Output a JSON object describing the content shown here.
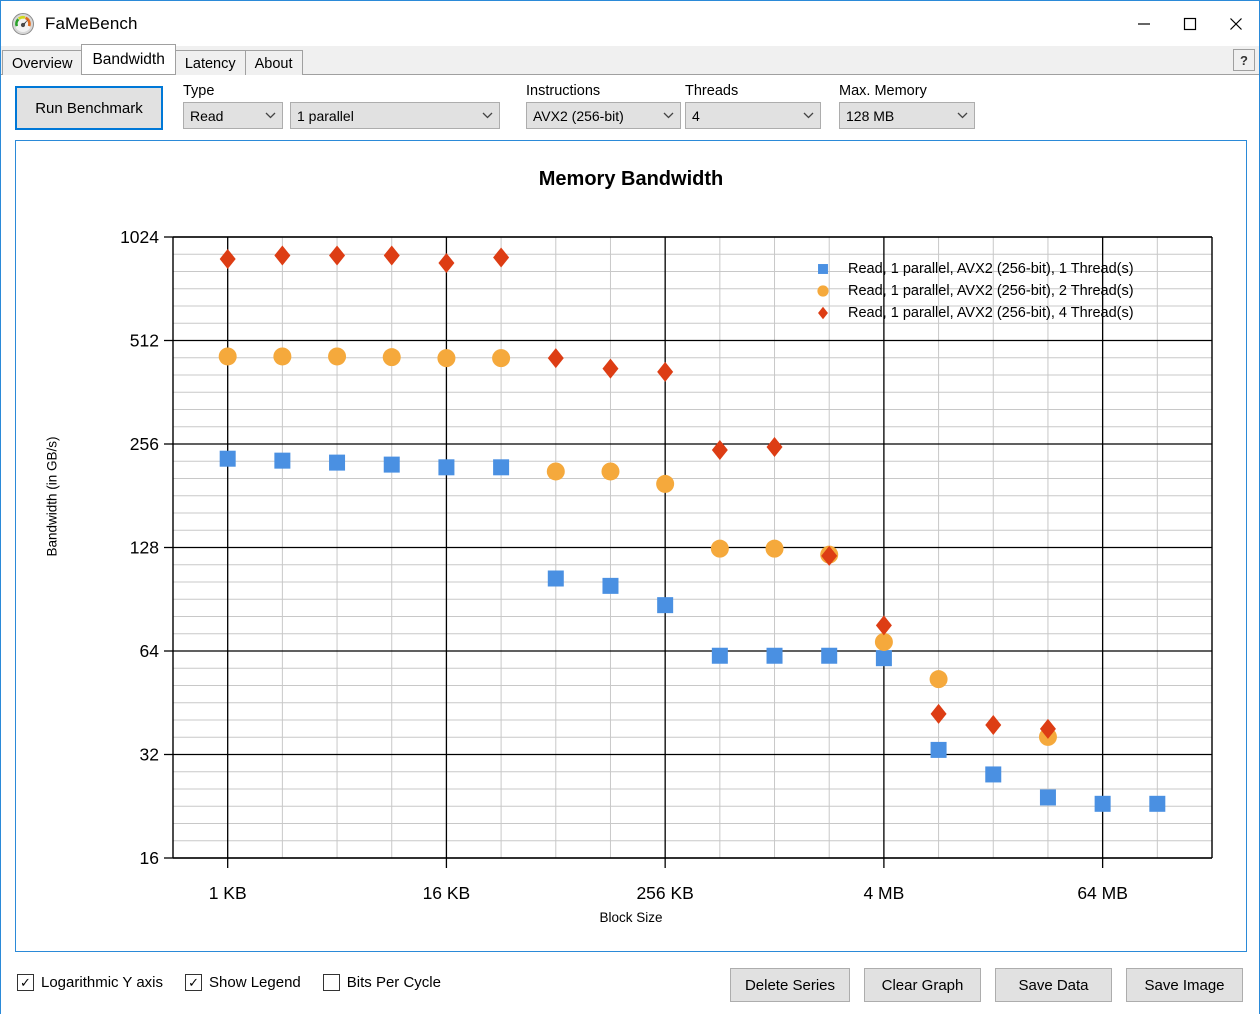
{
  "window": {
    "title": "FaMeBench",
    "icon": "gauge-icon",
    "minimize": "–",
    "maximize": "□",
    "close": "✕"
  },
  "tabs": [
    {
      "label": "Overview",
      "active": false
    },
    {
      "label": "Bandwidth",
      "active": true
    },
    {
      "label": "Latency",
      "active": false
    },
    {
      "label": "About",
      "active": false
    }
  ],
  "help_button": "?",
  "toolbar": {
    "run_label": "Run Benchmark",
    "fields": [
      {
        "label": "Type",
        "value": "Read"
      },
      {
        "label": "",
        "value": "1 parallel"
      },
      {
        "label": "Instructions",
        "value": "AVX2 (256-bit)"
      },
      {
        "label": "Threads",
        "value": "4"
      },
      {
        "label": "Max. Memory",
        "value": "128 MB"
      }
    ],
    "chevron": "⌄"
  },
  "checkboxes": [
    {
      "label": "Logarithmic Y axis",
      "checked": true,
      "mark": "✓"
    },
    {
      "label": "Show Legend",
      "checked": true,
      "mark": "✓"
    },
    {
      "label": "Bits Per Cycle",
      "checked": false,
      "mark": ""
    }
  ],
  "buttons": [
    {
      "label": "Delete Series"
    },
    {
      "label": "Clear Graph"
    },
    {
      "label": "Save Data"
    },
    {
      "label": "Save Image"
    }
  ],
  "colors": {
    "series1": "#4a90e2",
    "series2": "#f5a93c",
    "series3": "#dd3d14",
    "accent": "#0078d7",
    "grid_minor": "#c8c8c8",
    "grid_major": "#000000"
  },
  "chart_data": {
    "type": "scatter",
    "title": "Memory Bandwidth",
    "xlabel": "Block Size",
    "ylabel": "Bandwidth (in GB/s)",
    "log_y": true,
    "log_x": true,
    "ylim": [
      16,
      1024
    ],
    "yticks": [
      16,
      32,
      64,
      128,
      256,
      512,
      1024
    ],
    "ytick_labels": [
      "16",
      "32",
      "64",
      "128",
      "256",
      "512",
      "1024"
    ],
    "xticks": [
      1024,
      16384,
      262144,
      4194304,
      67108864
    ],
    "xtick_labels": [
      "1 KB",
      "16 KB",
      "256 KB",
      "4 MB",
      "64 MB"
    ],
    "x_block_sizes": [
      1024,
      2048,
      4096,
      8192,
      16384,
      32768,
      65536,
      131072,
      262144,
      524288,
      1048576,
      2097152,
      4194304,
      8388608,
      16777216,
      33554432,
      67108864,
      134217728
    ],
    "legend_position": "top-right",
    "series": [
      {
        "name": "Read, 1 parallel, AVX2 (256-bit), 1 Thread(s)",
        "color": "#4a90e2",
        "marker": "square",
        "values": [
          232,
          229,
          226,
          223,
          219,
          219,
          104,
          99,
          87,
          62,
          62,
          62,
          61,
          33,
          28,
          24,
          23,
          23
        ]
      },
      {
        "name": "Read, 1 parallel, AVX2 (256-bit), 2 Thread(s)",
        "color": "#f5a93c",
        "marker": "circle",
        "values": [
          460,
          460,
          460,
          458,
          455,
          455,
          213,
          213,
          196,
          127,
          127,
          122,
          68,
          53,
          null,
          36,
          null,
          null
        ]
      },
      {
        "name": "Read, 1 parallel, AVX2 (256-bit), 4 Thread(s)",
        "color": "#dd3d14",
        "marker": "diamond",
        "values": [
          884,
          905,
          905,
          905,
          860,
          893,
          455,
          424,
          415,
          246,
          251,
          121,
          76,
          42,
          39,
          38,
          null,
          null
        ]
      }
    ]
  }
}
